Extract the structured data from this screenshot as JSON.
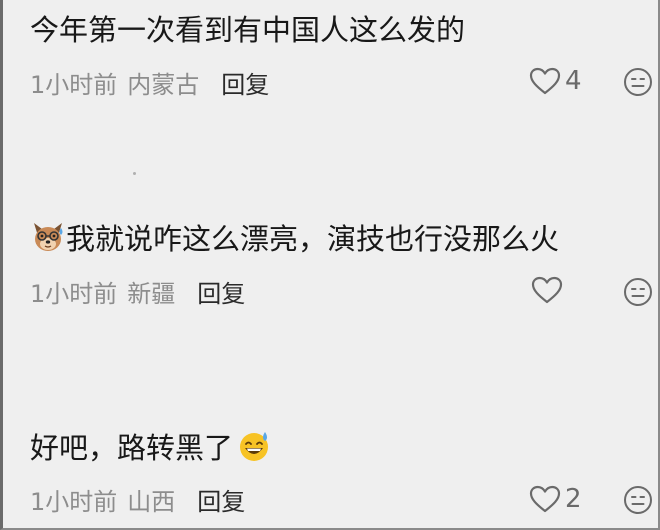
{
  "comments": [
    {
      "text": "今年第一次看到有中国人这么发的",
      "time": "1小时前",
      "location": "内蒙古",
      "reply": "回复",
      "likes": "4"
    },
    {
      "text": "我就说咋这么漂亮，演技也行没那么火",
      "time": "1小时前",
      "location": "新疆",
      "reply": "回复",
      "likes": ""
    },
    {
      "text": "好吧，路转黑了",
      "time": "1小时前",
      "location": "山西",
      "reply": "回复",
      "likes": "2"
    }
  ],
  "icons": {
    "like": "heart-outline-icon",
    "react": "face-emoji-icon",
    "avatar_emoji": "dog-face-emoji",
    "sweat_emoji": "grinning-sweat-emoji"
  },
  "colors": {
    "background": "#efefef",
    "text": "#181818",
    "meta": "#8d8d8d",
    "reply": "#2a2a2a",
    "icon": "#6a6a6a"
  }
}
